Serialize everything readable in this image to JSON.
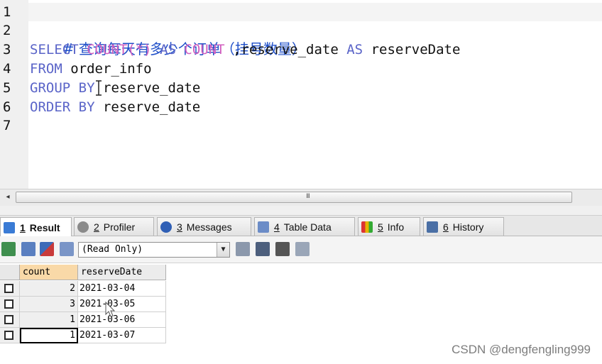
{
  "editor": {
    "line_numbers": [
      "1",
      "2",
      "3",
      "4",
      "5",
      "6",
      "7"
    ],
    "comment": "# 查询每天有多少个订单（挂号数量）",
    "line3": {
      "select": "SELECT",
      "count_fn": "COUNT(*)",
      "as1": "AS",
      "count_alias": "COUNT",
      "column": ",reserve_date",
      "as2": "AS",
      "alias": "reserveDate"
    },
    "line4": {
      "from": "FROM",
      "table": "order_info"
    },
    "line5": {
      "group": "GROUP",
      "by": "BY",
      "column": "reserve_date"
    },
    "line6": {
      "order": "ORDER BY",
      "column": "reserve_date"
    }
  },
  "scrollbar": {
    "grip": "III",
    "left_arrow": "◂"
  },
  "tabs": [
    {
      "num": "1",
      "label": "Result",
      "icon": "result-icon",
      "color": "#3a7bd5"
    },
    {
      "num": "2",
      "label": "Profiler",
      "icon": "profiler-icon",
      "color": "#7a7a7a"
    },
    {
      "num": "3",
      "label": "Messages",
      "icon": "messages-icon",
      "color": "#2f5fb5"
    },
    {
      "num": "4",
      "label": "Table Data",
      "icon": "table-data-icon",
      "color": "#6b8cc7"
    },
    {
      "num": "5",
      "label": "Info",
      "icon": "info-icon",
      "color": "#d9a400"
    },
    {
      "num": "6",
      "label": "History",
      "icon": "history-icon",
      "color": "#4a6fa5"
    }
  ],
  "result_toolbar": {
    "mode_select": "(Read Only)",
    "dropdown_arrow": "▼"
  },
  "grid": {
    "columns": [
      "count",
      "reserveDate"
    ],
    "rows": [
      {
        "count": "2",
        "reserveDate": "2021-03-04"
      },
      {
        "count": "3",
        "reserveDate": "2021-03-05"
      },
      {
        "count": "1",
        "reserveDate": "2021-03-06"
      },
      {
        "count": "1",
        "reserveDate": "2021-03-07"
      }
    ]
  },
  "watermark": "CSDN @dengfengling999"
}
